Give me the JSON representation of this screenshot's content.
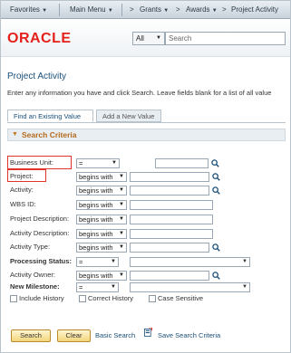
{
  "nav": {
    "favorites": "Favorites",
    "main_menu": "Main Menu",
    "crumbs": [
      "Grants",
      "Awards",
      "Project Activity"
    ],
    "crumb_sep": ">"
  },
  "brand": {
    "logo": "ORACLE"
  },
  "search": {
    "scope": "All",
    "placeholder": "Search"
  },
  "page": {
    "title": "Project Activity",
    "instructions": "Enter any information you have and click Search. Leave fields blank for a list of all value"
  },
  "tabs": {
    "find_existing": "Find an Existing Value",
    "add_new": "Add a New Value"
  },
  "criteria": {
    "header": "Search Criteria",
    "fields": [
      {
        "label": "Business Unit:",
        "operator": "="
      },
      {
        "label": "Project:",
        "operator": "begins with"
      },
      {
        "label": "Activity:",
        "operator": "begins with"
      },
      {
        "label": "WBS ID:",
        "operator": "begins with"
      },
      {
        "label": "Project Description:",
        "operator": "begins with"
      },
      {
        "label": "Activity Description:",
        "operator": "begins with"
      },
      {
        "label": "Activity Type:",
        "operator": "begins with"
      },
      {
        "label": "Processing Status:",
        "operator": "="
      },
      {
        "label": "Activity Owner:",
        "operator": "begins with"
      },
      {
        "label": "New Milestone:",
        "operator": "="
      }
    ]
  },
  "options": {
    "include_history": "Include History",
    "correct_history": "Correct History",
    "case_sensitive": "Case Sensitive"
  },
  "actions": {
    "search": "Search",
    "clear": "Clear",
    "basic_search": "Basic Search",
    "save_criteria": "Save Search Criteria"
  },
  "colors": {
    "accent": "#1a4f7a",
    "brand_red": "#e3201b",
    "highlight_box": "#e0342b",
    "criteria_header": "#b46a1b"
  },
  "icons": {
    "lookup": "magnifier-icon",
    "dropdown": "chevron-down-icon",
    "save": "save-criteria-icon"
  }
}
